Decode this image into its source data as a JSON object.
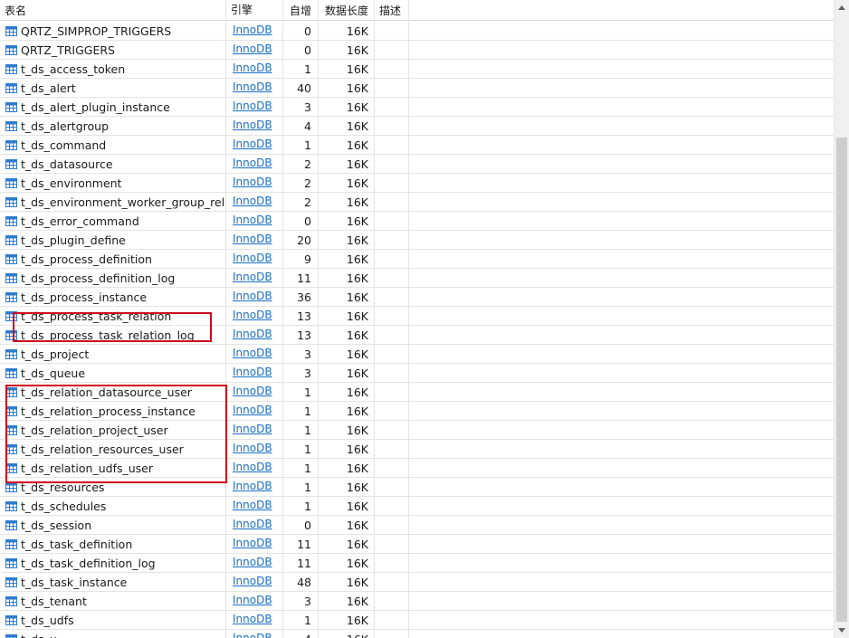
{
  "columns": {
    "name": "表名",
    "engine": "引擎",
    "auto_increment": "自增",
    "data_length": "数据长度",
    "comment": "描述"
  },
  "rows": [
    {
      "name": "QRTZ_SIMPROP_TRIGGERS",
      "engine": "InnoDB",
      "auto": "0",
      "length": "16K"
    },
    {
      "name": "QRTZ_TRIGGERS",
      "engine": "InnoDB",
      "auto": "0",
      "length": "16K"
    },
    {
      "name": "t_ds_access_token",
      "engine": "InnoDB",
      "auto": "1",
      "length": "16K"
    },
    {
      "name": "t_ds_alert",
      "engine": "InnoDB",
      "auto": "40",
      "length": "16K"
    },
    {
      "name": "t_ds_alert_plugin_instance",
      "engine": "InnoDB",
      "auto": "3",
      "length": "16K"
    },
    {
      "name": "t_ds_alertgroup",
      "engine": "InnoDB",
      "auto": "4",
      "length": "16K"
    },
    {
      "name": "t_ds_command",
      "engine": "InnoDB",
      "auto": "1",
      "length": "16K"
    },
    {
      "name": "t_ds_datasource",
      "engine": "InnoDB",
      "auto": "2",
      "length": "16K"
    },
    {
      "name": "t_ds_environment",
      "engine": "InnoDB",
      "auto": "2",
      "length": "16K"
    },
    {
      "name": "t_ds_environment_worker_group_rela…",
      "engine": "InnoDB",
      "auto": "2",
      "length": "16K"
    },
    {
      "name": "t_ds_error_command",
      "engine": "InnoDB",
      "auto": "0",
      "length": "16K"
    },
    {
      "name": "t_ds_plugin_define",
      "engine": "InnoDB",
      "auto": "20",
      "length": "16K"
    },
    {
      "name": "t_ds_process_definition",
      "engine": "InnoDB",
      "auto": "9",
      "length": "16K"
    },
    {
      "name": "t_ds_process_definition_log",
      "engine": "InnoDB",
      "auto": "11",
      "length": "16K"
    },
    {
      "name": "t_ds_process_instance",
      "engine": "InnoDB",
      "auto": "36",
      "length": "16K"
    },
    {
      "name": "t_ds_process_task_relation",
      "engine": "InnoDB",
      "auto": "13",
      "length": "16K"
    },
    {
      "name": "t_ds_process_task_relation_log",
      "engine": "InnoDB",
      "auto": "13",
      "length": "16K"
    },
    {
      "name": "t_ds_project",
      "engine": "InnoDB",
      "auto": "3",
      "length": "16K"
    },
    {
      "name": "t_ds_queue",
      "engine": "InnoDB",
      "auto": "3",
      "length": "16K"
    },
    {
      "name": "t_ds_relation_datasource_user",
      "engine": "InnoDB",
      "auto": "1",
      "length": "16K"
    },
    {
      "name": "t_ds_relation_process_instance",
      "engine": "InnoDB",
      "auto": "1",
      "length": "16K"
    },
    {
      "name": "t_ds_relation_project_user",
      "engine": "InnoDB",
      "auto": "1",
      "length": "16K"
    },
    {
      "name": "t_ds_relation_resources_user",
      "engine": "InnoDB",
      "auto": "1",
      "length": "16K"
    },
    {
      "name": "t_ds_relation_udfs_user",
      "engine": "InnoDB",
      "auto": "1",
      "length": "16K"
    },
    {
      "name": "t_ds_resources",
      "engine": "InnoDB",
      "auto": "1",
      "length": "16K"
    },
    {
      "name": "t_ds_schedules",
      "engine": "InnoDB",
      "auto": "1",
      "length": "16K"
    },
    {
      "name": "t_ds_session",
      "engine": "InnoDB",
      "auto": "0",
      "length": "16K"
    },
    {
      "name": "t_ds_task_definition",
      "engine": "InnoDB",
      "auto": "11",
      "length": "16K"
    },
    {
      "name": "t_ds_task_definition_log",
      "engine": "InnoDB",
      "auto": "11",
      "length": "16K"
    },
    {
      "name": "t_ds_task_instance",
      "engine": "InnoDB",
      "auto": "48",
      "length": "16K"
    },
    {
      "name": "t_ds_tenant",
      "engine": "InnoDB",
      "auto": "3",
      "length": "16K"
    },
    {
      "name": "t_ds_udfs",
      "engine": "InnoDB",
      "auto": "1",
      "length": "16K"
    },
    {
      "name": "t_ds_u",
      "engine": "InnoDB",
      "auto": "4",
      "length": "16K"
    }
  ],
  "icons": {
    "table": "table-icon",
    "scroll_up": "scroll-up-arrow-icon",
    "scroll_down": "scroll-down-arrow-icon"
  },
  "colors": {
    "link": "#1a6fc4",
    "table_icon": "#2d7bd0",
    "highlight": "#d0021b",
    "gridline": "#e4e4e4"
  },
  "highlights": [
    {
      "label": "process-task-relation-group",
      "rows": [
        "t_ds_process_task_relation",
        "t_ds_process_task_relation_log"
      ]
    },
    {
      "label": "relation-group",
      "rows": [
        "t_ds_relation_datasource_user",
        "t_ds_relation_process_instance",
        "t_ds_relation_project_user",
        "t_ds_relation_resources_user",
        "t_ds_relation_udfs_user"
      ]
    }
  ]
}
